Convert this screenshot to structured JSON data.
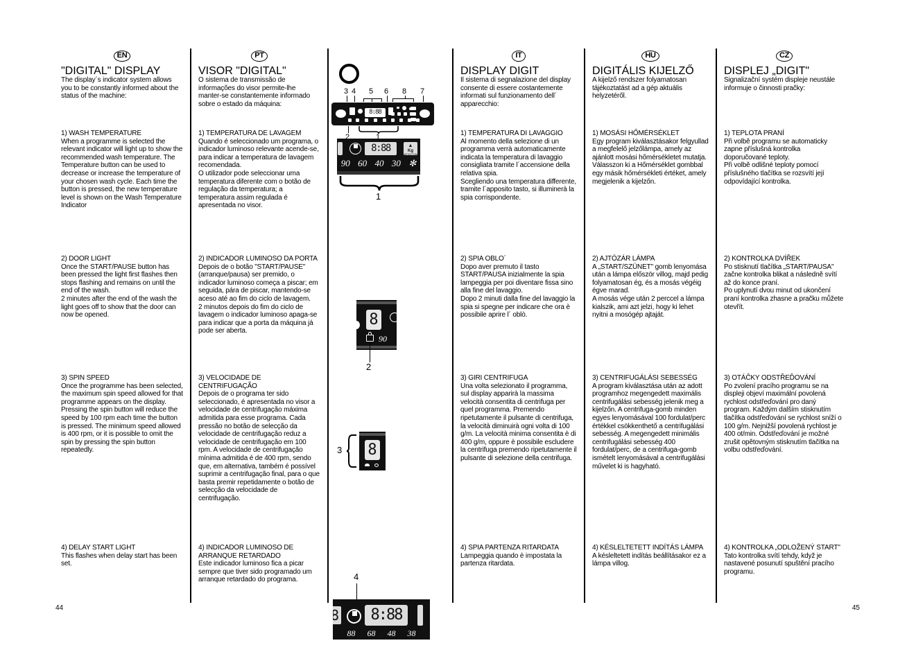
{
  "page": {
    "left_number": "44",
    "right_number": "45"
  },
  "columns": {
    "en": {
      "lang": "EN",
      "heading": "\"DIGITAL\" DISPLAY",
      "intro": "The display´s indicator system allows you to be constantly informed about the status of the machine:",
      "s1_title": "1) WASH TEMPERATURE",
      "s1_body": "When a programme is selected the relevant indicator will light up to show the recommended wash temperature. The Temperature button can be used to decrease or increase the temperature of your chosen wash cycle. Each time the button is pressed, the new temperature level is shown on the Wash Temperature Indicator",
      "s2_title": "2) DOOR LIGHT",
      "s2_body": "Once the START/PAUSE button has been pressed the light first flashes then stops flashing and remains on until the end of the wash.\n2 minutes after the end of the wash the light goes off to show that the door can now be opened.",
      "s3_title": "3) SPIN SPEED",
      "s3_body": "Once the programme has been selected, the maximum spin speed allowed for that programme appears on the display.  Pressing the spin button will reduce the speed by 100 rpm each time the button is pressed.  The minimum speed allowed is 400 rpm, or it is possible to omit the spin by pressing the spin button repeatedly.",
      "s4_title": "4) DELAY START LIGHT",
      "s4_body": "This flashes when delay start has been set."
    },
    "pt": {
      "lang": "PT",
      "heading": "VISOR \"DIGITAL\"",
      "intro": "O sistema de transmissão de informações do visor permite-lhe manter-se constantemente informado sobre o estado da máquina:",
      "s1_title": "1) TEMPERATURA DE LAVAGEM",
      "s1_body": "Quando é seleccionado um programa, o indicador luminoso relevante acende-se, para indicar a temperatura de lavagem recomendada.\nO utilizador pode seleccionar uma temperatura diferente com o botão de regulação da temperatura; a temperatura assim regulada é apresentada no visor.",
      "s2_title": "2) INDICADOR LUMINOSO DA PORTA",
      "s2_body": "Depois de o botão \"START/PAUSE\" (arranque/pausa) ser premido, o indicador luminoso começa a piscar; em seguida, pára de piscar, mantendo-se aceso até ao fim do ciclo de lavagem.\n2 minutos depois do fim do ciclo de lavagem o indicador luminoso apaga-se para indicar que a porta da máquina já pode ser aberta.",
      "s3_title": "3) VELOCIDADE DE CENTRIFUGAÇÃO",
      "s3_body": "Depois de o programa ter sido seleccionado, é apresentada no visor a velocidade de centrifugação máxima admitida para esse programa.  Cada pressão no botão de selecção da velocidade de centrifugação reduz a velocidade de centrifugação em 100 rpm.  A velocidade de centrifugação mínima admitida é de 400 rpm, sendo que, em alternativa, também é possível suprimir a centrifugação final, para o que basta premir repetidamente o botão de selecção da velocidade de centrifugação.",
      "s4_title": "4) INDICADOR LUMINOSO DE ARRANQUE RETARDADO",
      "s4_body": "Este indicador luminoso fica a picar sempre que tiver sido programado um arranque retardado do programa."
    },
    "it": {
      "lang": "IT",
      "heading": "DISPLAY DIGIT",
      "intro": "Il sistema di segnalazione del display consente di essere costantemente informati sul funzionamento dell´ apparecchio:",
      "s1_title": "1) TEMPERATURA DI LAVAGGIO",
      "s1_body": "Al momento della selezione di un programma verrà automaticamente indicata la temperatura di lavaggio consigliata tramite l´accensione della relativa spia.\nScegliendo una temperatura differente, tramite l´apposito tasto, si illuminerà la spia corrispondente.",
      "s2_title": "2) SPIA OBLO´",
      "s2_body": "Dopo aver premuto il tasto START/PAUSA inizialmente la spia lampeggia per poi diventare fissa sino alla fine del lavaggio.\nDopo 2 minuti dalla fine del lavaggio la spia si spegne per indicare che ora è possibile aprire l´ oblò.",
      "s3_title": "3) GIRI CENTRIFUGA",
      "s3_body": "Una volta selezionato il programma, sul display apparirà la massima velocità consentita di centrifuga per quel programma. Premendo ripetutamente il pulsante di centrifuga, la velocità diminuirà ogni volta di 100 g/m. La velocità minima consentita è di 400 g/m, oppure è possibile escludere la centrifuga premendo ripetutamente il pulsante di selezione della centrifuga.",
      "s4_title": "4) SPIA PARTENZA RITARDATA",
      "s4_body": "Lampeggia quando è impostata la partenza ritardata."
    },
    "hu": {
      "lang": "HU",
      "heading": "DIGITÁLIS KIJELZŐ",
      "intro": "A kijelző rendszer folyamatosan tájékoztatást ad a gép aktuális helyzetéről.",
      "s1_title": "1) MOSÁSI HŐMÉRSÉKLET",
      "s1_body": "Egy program kiválasztásakor felgyullad a megfelelő jelzőlámpa, amely az ajánlott mosási hőmérsékletet mutatja.\nVálasszon ki a Hőmérséklet gombbal egy másik hőmérsékleti értéket, amely megjelenik a kijelzőn.",
      "s2_title": "2) AJTÓZÁR LÁMPA",
      "s2_body": "A „START/SZÜNET\" gomb lenyomása után a lámpa először villog, majd pedig folyamatosan ég, és a mosás végéig égve marad.\nA mosás vége után 2 perccel a lámpa kialszik, ami azt jelzi, hogy ki lehet nyitni a mosógép ajtaját.",
      "s3_title": "3) CENTRIFUGÁLÁSI SEBESSÉG",
      "s3_body": "A program kiválasztása után az adott programhoz megengedett maximális centrifugálási sebesség jelenik meg a kijelzőn.  A centrifuga-gomb minden egyes lenyomásával 100 fordulat/perc értékkel csökkenthető a centrifugálási sebesség.  A megengedett minimális centrifugálási sebesség 400 fordulat/perc, de a centrifuga-gomb ismételt lenyomásával a centrifugálási művelet ki is hagyható.",
      "s4_title": "4) KÉSLELTETETT INDÍTÁS LÁMPA",
      "s4_body": "A késleltetett indítás beállításakor ez a lámpa villog."
    },
    "cz": {
      "lang": "CZ",
      "heading": "DISPLEJ „DIGIT\"",
      "intro": "Signalizační systém displeje neustále informuje o činnosti pračky:",
      "s1_title": "1) TEPLOTA PRANÍ",
      "s1_body": "Při volbě programu se automaticky zapne příslušná kontrolka doporučované teploty.\nPři volbě odlišné teploty pomocí příslušného tlačítka se rozsvítí její odpovídající kontrolka.",
      "s2_title": "2) KONTROLKA DVÍŘEK",
      "s2_body": "Po stisknutí tlačítka „START/PAUSA\" začne kontrolka blikat a následně svítí až do konce praní.\nPo uplynutí dvou minut od ukončení praní kontrolka zhasne a pračku můžete otevřít.",
      "s3_title": "3) OTÁČKY ODSTŘEĎOVÁNÍ",
      "s3_body": "Po zvolení pracího programu se na displeji objeví maximální povolená rychlost odstřeďování pro daný program. Každým dalším stisknutím tlačítka odstřeďování se rychlost sníží o  100 g/m. Nejnižší povolená rychlost je 400 ot/min. Odstřeďování je možné zrušit opětovným stisknutím tlačítka na volbu odstřeďování.",
      "s4_title": "4) KONTROLKA „ODLOŽENÝ START\"",
      "s4_body": "Tato kontrolka svítí tehdy, když je nastavené posunutí spuštění pracího programu."
    }
  },
  "figures": {
    "panel": {
      "callouts": [
        "3",
        "4",
        "5",
        "6",
        "8",
        "7",
        "2",
        "1"
      ],
      "segment_text": "8:88"
    },
    "temperature_strip": {
      "callout": "1",
      "segment_text": "8:88",
      "kg_label": "Kg",
      "kg_sub": "DETECTOR",
      "values": [
        "90",
        "60",
        "40",
        "30",
        "✻"
      ]
    },
    "door_lock": {
      "callout": "2",
      "digit": "8",
      "temp_label": "90"
    },
    "spin": {
      "callout": "3",
      "digit": "8"
    },
    "delay_start": {
      "callout": "4",
      "left_digit": "8",
      "segment_text": "8:88",
      "values": [
        "88",
        "68",
        "48",
        "38"
      ]
    }
  }
}
